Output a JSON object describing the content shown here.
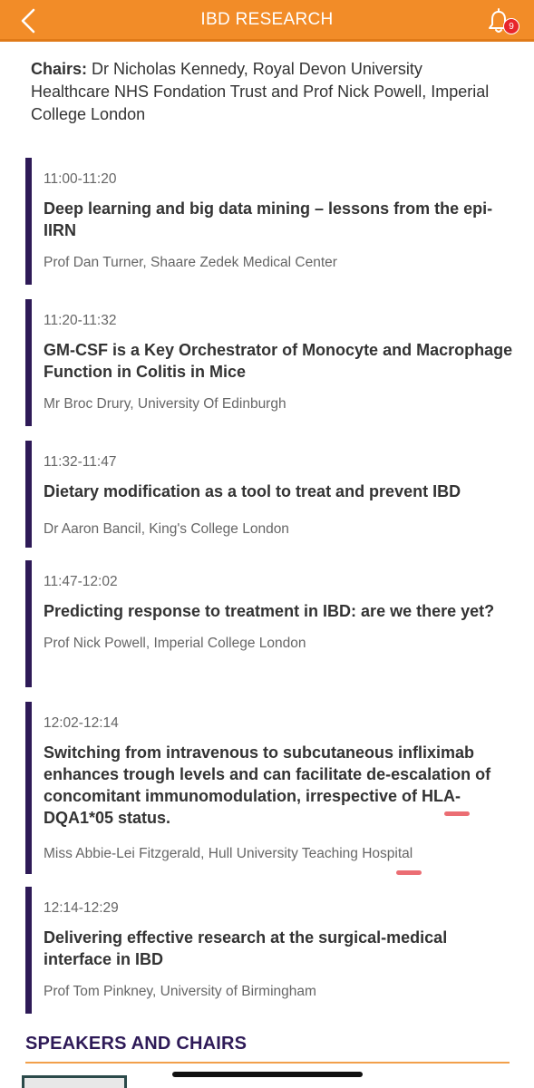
{
  "header": {
    "title": "IBD RESEARCH",
    "back_icon": "chevron-left-icon",
    "bell_icon": "bell-icon",
    "notification_count": "9",
    "bar_color": "#f28c28"
  },
  "chairs": {
    "label": "Chairs:",
    "text": " Dr Nicholas Kennedy, Royal Devon University Healthcare NHS Fondation Trust and Prof Nick Powell, Imperial College London"
  },
  "sessions": [
    {
      "time": "11:00-11:20",
      "title": "Deep learning and big data mining – lessons from the epi-IIRN",
      "speaker": "Prof Dan Turner, Shaare Zedek Medical Center"
    },
    {
      "time": "11:20-11:32",
      "title": "GM-CSF is a Key Orchestrator of Monocyte and Macrophage Function in Colitis in Mice",
      "speaker": "Mr Broc Drury, University Of Edinburgh"
    },
    {
      "time": "11:32-11:47",
      "title": "Dietary modification as a tool to treat and prevent IBD",
      "speaker": "Dr Aaron Bancil, King's College London"
    },
    {
      "time": "11:47-12:02",
      "title": "Predicting response to treatment in IBD: are we there yet?",
      "speaker": "Prof Nick Powell, Imperial College London"
    },
    {
      "time": "12:02-12:14",
      "title": "Switching from intravenous to subcutaneous infliximab enhances trough levels and can facilitate de-escalation of concomitant immunomodulation, irrespective of HLA-DQA1*05 status.",
      "speaker": "Miss Abbie-Lei Fitzgerald, Hull University Teaching Hospital"
    },
    {
      "time": "12:14-12:29",
      "title": "Delivering effective research at the surgical-medical interface in IBD",
      "speaker": "Prof Tom Pinkney, University of Birmingham"
    }
  ],
  "speakers_section": {
    "heading": "SPEAKERS AND CHAIRS",
    "heading_color": "#2e1a57",
    "accent_color": "#2e1a57"
  }
}
